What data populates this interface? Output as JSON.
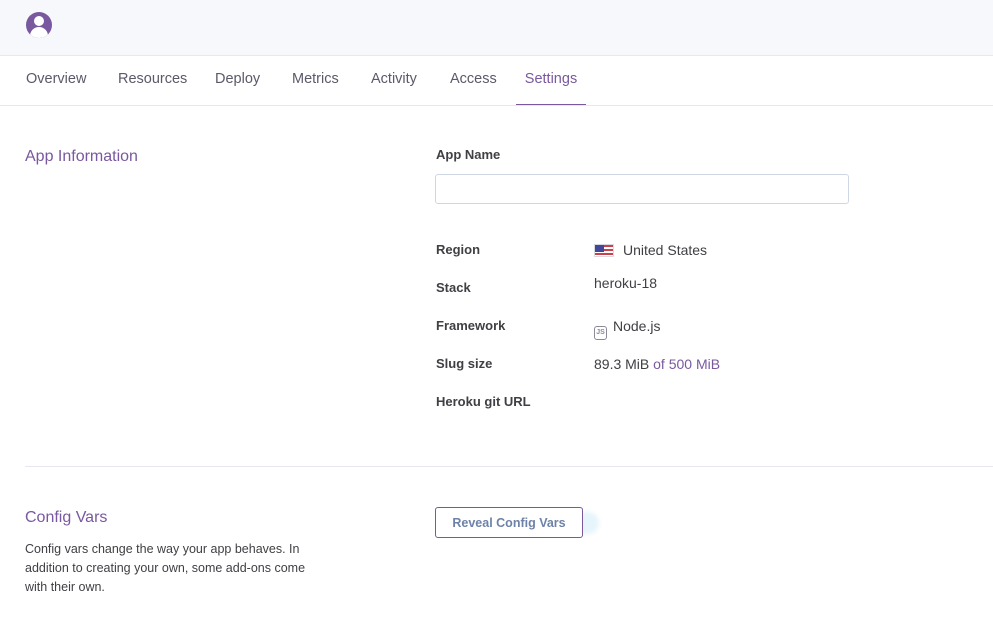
{
  "nav": {
    "tabs": [
      {
        "label": "Overview"
      },
      {
        "label": "Resources"
      },
      {
        "label": "Deploy"
      },
      {
        "label": "Metrics"
      },
      {
        "label": "Activity"
      },
      {
        "label": "Access"
      },
      {
        "label": "Settings",
        "active": true
      }
    ]
  },
  "app_information": {
    "title": "App Information",
    "app_name_label": "App Name",
    "app_name_value": "",
    "rows": [
      {
        "label": "Region",
        "value": "United States",
        "icon": "us-flag-icon"
      },
      {
        "label": "Stack",
        "value": "heroku-18"
      },
      {
        "label": "Framework",
        "value": "Node.js",
        "icon": "nodejs-icon"
      },
      {
        "label": "Slug size",
        "value": "89.3 MiB",
        "value_suffix": "of 500 MiB"
      },
      {
        "label": "Heroku git URL",
        "value": ""
      }
    ]
  },
  "config_vars": {
    "title": "Config Vars",
    "description": "Config vars change the way your app behaves. In addition to creating your own, some add-ons come with their own.",
    "reveal_button_label": "Reveal Config Vars"
  },
  "colors": {
    "accent": "#79589f",
    "topbar_bg": "#f7f8fb",
    "border": "#e7e7ef"
  }
}
